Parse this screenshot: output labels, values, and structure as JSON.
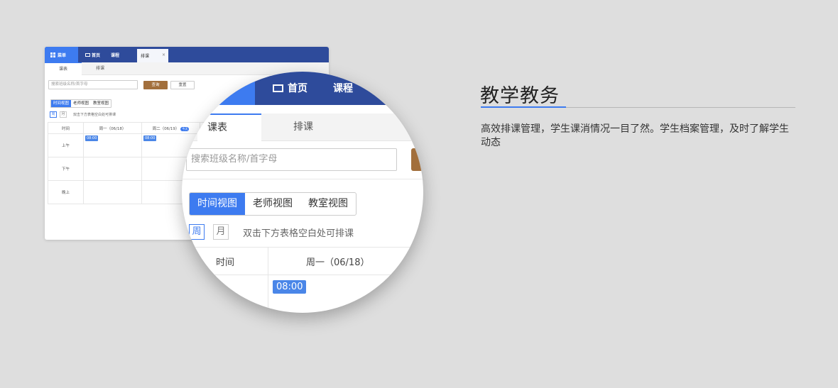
{
  "mini": {
    "menu_label": "菜单",
    "nav_home": "首页",
    "nav_course": "课程",
    "open_tab": "排课",
    "tab_close": "×",
    "tabs": [
      "课表",
      "排课"
    ],
    "search_placeholder": "搜索班级名称/首字母",
    "query_button": "查询",
    "reset_button": "重置",
    "views": [
      "时间视图",
      "老师视图",
      "教室视图"
    ],
    "week": "周",
    "month": "月",
    "hint": "双击下方表格空白处可排课",
    "table": {
      "headers": [
        "时间",
        "周一（06/18）",
        "周二（06/19）"
      ],
      "today": "今天",
      "rows": [
        "上午",
        "下午",
        "晚上"
      ],
      "slot_time": "08:00"
    }
  },
  "zoom": {
    "nav_home": "首页",
    "nav_course": "课程",
    "tabs": [
      "课表",
      "排课"
    ],
    "search_placeholder": "搜索班级名称/首字母",
    "views": [
      "时间视图",
      "老师视图",
      "教室视图"
    ],
    "week": "周",
    "month": "月",
    "hint": "双击下方表格空白处可排课",
    "headers": [
      "时间",
      "周一（06/18）"
    ],
    "slot_time": "08:00"
  },
  "feature": {
    "title": "教学教务",
    "description": "高效排课管理，学生课消情况一目了然。学生档案管理，及时了解学生动态"
  },
  "colors": {
    "primary": "#3d7bf0",
    "nav": "#2e4b9b",
    "query_button": "#a26f3c",
    "background": "#dedede"
  }
}
